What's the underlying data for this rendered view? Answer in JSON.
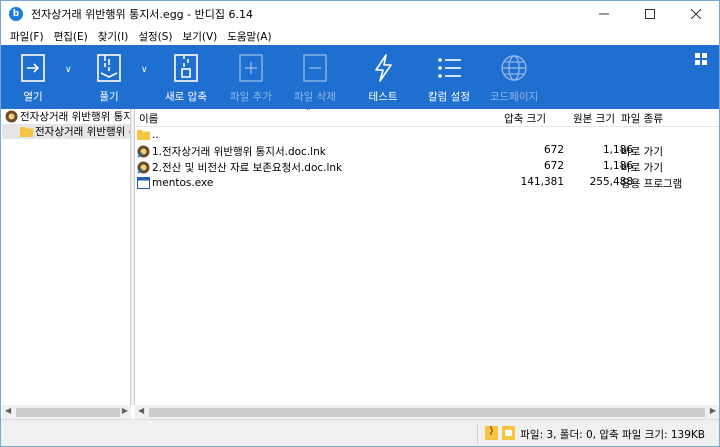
{
  "window": {
    "title": "전자상거래 위반행위 통지서.egg - 반디집 6.14",
    "app_icon_letter": "b"
  },
  "menu": [
    "파일(F)",
    "편집(E)",
    "찾기(I)",
    "설정(S)",
    "보기(V)",
    "도움말(A)"
  ],
  "toolbar": {
    "open": "열기",
    "extract": "풀기",
    "new_archive": "새로 압축",
    "add_file": "파일 추가",
    "delete_file": "파일 삭제",
    "test": "테스트",
    "column_settings": "칼럼 설정",
    "codepage": "코드페이지"
  },
  "tree": {
    "root": "전자상거래 위반행위 통지서.egg",
    "child": "전자상거래 위반행위 통지서.egg"
  },
  "list": {
    "headers": {
      "name": "이름",
      "packed": "압축 크기",
      "original": "원본 크기",
      "type": "파일 종류"
    },
    "parent_dir": "..",
    "rows": [
      {
        "name": "1.전자상거래 위반행위 통지서.doc.lnk",
        "packed": "672",
        "original": "1,186",
        "type": "바로 가기",
        "icon": "shortcut-icon"
      },
      {
        "name": "2.전산 및 비전산 자료 보존요청서.doc.lnk",
        "packed": "672",
        "original": "1,186",
        "type": "바로 가기",
        "icon": "shortcut-icon"
      },
      {
        "name": "mentos.exe",
        "packed": "141,381",
        "original": "255,488",
        "type": "응용 프로그램",
        "icon": "exe-icon"
      }
    ]
  },
  "status": {
    "text": "파일: 3, 폴더: 0, 압축 파일 크기: 139KB"
  },
  "colors": {
    "toolbar_bg": "#1f6fd1",
    "toolbar_text": "#ffffff",
    "toolbar_disabled_text": "#8fb4e6"
  }
}
